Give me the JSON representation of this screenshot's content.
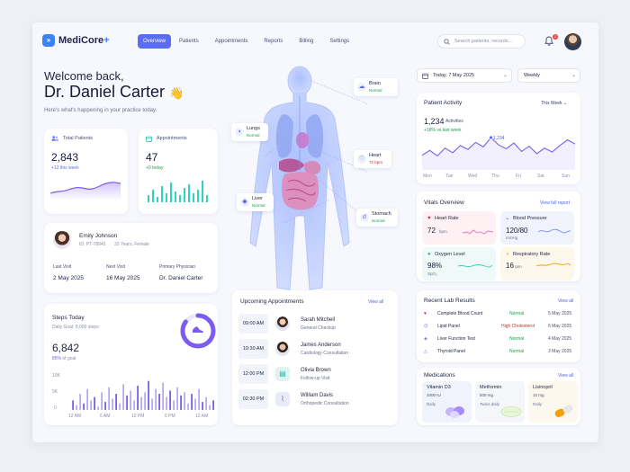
{
  "app": {
    "brand": "MediCore",
    "brand_plus": "+"
  },
  "nav": {
    "items": [
      "Overview",
      "Patients",
      "Appointments",
      "Reports",
      "Billing",
      "Settings"
    ],
    "active": "Overview"
  },
  "search": {
    "placeholder": "Search patients, records..."
  },
  "notifications": {
    "count": "2"
  },
  "welcome": {
    "greeting": "Welcome back,",
    "name": "Dr. Daniel Carter",
    "wave": "👋",
    "subtitle": "Here's what's happening in your practice today."
  },
  "stats": {
    "total_patients": {
      "label": "Total Patients",
      "value": "2,843",
      "delta": "+12 this week"
    },
    "appointments": {
      "label": "Appointments",
      "value": "47",
      "delta": "+0 today"
    }
  },
  "patient": {
    "name": "Emily Johnson",
    "id": "ID: PT-78945",
    "meta": "32 Years, Female",
    "last_visit_label": "Last Visit",
    "last_visit": "2 May 2025",
    "next_visit_label": "Next Visit",
    "next_visit": "16 May 2025",
    "physician_label": "Primary Physician",
    "physician": "Dr. Daniel Carter"
  },
  "steps": {
    "title": "Steps Today",
    "goal_text": "Daily Goal: 8,000 steps",
    "value": "6,842",
    "percent_text": "85%",
    "goal_suffix": "of goal",
    "progress": 0.85,
    "y_ticks": [
      "10K",
      "5K",
      "0"
    ],
    "x_ticks": [
      "12 AM",
      "6 AM",
      "12 PM",
      "6 PM",
      "12 AM"
    ],
    "bars": [
      0.3,
      0.15,
      0.5,
      0.2,
      0.65,
      0.3,
      0.4,
      0.1,
      0.55,
      0.25,
      0.7,
      0.35,
      0.5,
      0.2,
      0.8,
      0.45,
      0.6,
      0.3,
      0.75,
      0.4,
      0.55,
      0.9,
      0.35,
      0.65,
      0.5,
      0.85,
      0.4,
      0.6,
      0.3,
      0.7,
      0.45,
      0.55,
      0.2,
      0.5,
      0.35,
      0.65,
      0.25,
      0.4,
      0.15,
      0.3
    ]
  },
  "anatomy": {
    "brain": {
      "label": "Brain",
      "status": "Normal"
    },
    "lungs": {
      "label": "Lungs",
      "status": "Normal"
    },
    "heart": {
      "label": "Heart",
      "status": "72 bpm"
    },
    "liver": {
      "label": "Liver",
      "status": "Normal"
    },
    "stomach": {
      "label": "Stomach",
      "status": "Normal"
    }
  },
  "appointments": {
    "title": "Upcoming Appointments",
    "view_all": "View all",
    "items": [
      {
        "time": "09:00 AM",
        "name": "Sarah Mitchell",
        "type": "General Checkup",
        "bg": "#f3f1fe"
      },
      {
        "time": "10:30 AM",
        "name": "James Anderson",
        "type": "Cardiology Consultation",
        "bg": "#fdf1f3"
      },
      {
        "time": "12:00 PM",
        "name": "Olivia Brown",
        "type": "Follow-up Visit",
        "bg": "#f0f7f7"
      },
      {
        "time": "02:30 PM",
        "name": "William Davis",
        "type": "Orthopedic Consultation",
        "bg": "#f2f4fb"
      }
    ]
  },
  "date": {
    "value": "Today, 7 May 2025",
    "range": "Weekly"
  },
  "activity": {
    "title": "Patient Activity",
    "period": "This Week",
    "value": "1,234",
    "value_label": "Activities",
    "delta": "+18% vs last week",
    "days": [
      "Mon",
      "Tue",
      "Wed",
      "Thu",
      "Fri",
      "Sat",
      "Sun"
    ],
    "highlight": "1,234",
    "series": [
      40,
      55,
      38,
      62,
      48,
      70,
      58,
      80,
      66,
      95,
      72,
      60,
      78,
      52,
      68,
      45,
      62,
      50,
      70,
      88,
      75
    ]
  },
  "vitals": {
    "title": "Vitals Overview",
    "view_all": "View full report",
    "heart_rate": {
      "label": "Heart Rate",
      "value": "72",
      "unit": "bpm"
    },
    "blood_pressure": {
      "label": "Blood Pressure",
      "value": "120/80",
      "unit": "mmHg"
    },
    "oxygen": {
      "label": "Oxygen Level",
      "value": "98%",
      "unit": "SpO₂"
    },
    "respiratory": {
      "label": "Respiratory Rate",
      "value": "16",
      "unit": "rpm"
    }
  },
  "labs": {
    "title": "Recent Lab Results",
    "view_all": "View all",
    "rows": [
      {
        "test": "Complete Blood Count",
        "status": "Normal",
        "date": "5 May 2025",
        "color": "#16a34a",
        "icon": "♥"
      },
      {
        "test": "Lipid Panel",
        "status": "High Cholesterol",
        "date": "6 May 2025",
        "color": "#dc2626",
        "icon": "⌬"
      },
      {
        "test": "Liver Function Test",
        "status": "Normal",
        "date": "4 May 2025",
        "color": "#16a34a",
        "icon": "◈"
      },
      {
        "test": "Thyroid Panel",
        "status": "Normal",
        "date": "3 May 2025",
        "color": "#16a34a",
        "icon": "△"
      }
    ]
  },
  "medications": {
    "title": "Medications",
    "view_all": "View all",
    "items": [
      {
        "name": "Vitamin D3",
        "dose": "1000 IU",
        "freq": "Daily",
        "bg": "#f1f3fc"
      },
      {
        "name": "Metformin",
        "dose": "500 mg",
        "freq": "Twice daily",
        "bg": "#f4f6f9"
      },
      {
        "name": "Lisinopril",
        "dose": "10 mg",
        "freq": "Daily",
        "bg": "#fdf8ee"
      }
    ]
  },
  "colors": {
    "accent": "#5b6df0",
    "brand": "#3b82f6",
    "positive": "#16a34a",
    "alert": "#dc2626"
  }
}
